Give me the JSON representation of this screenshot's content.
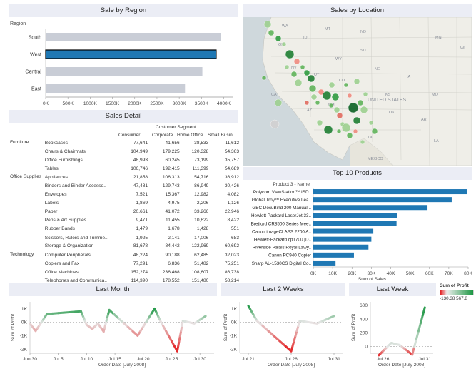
{
  "sales_by_region": {
    "title": "Sale by Region",
    "dimension_label": "Region",
    "axis_label": "Sum of Sales",
    "ticks": [
      "0K",
      "500K",
      "1000K",
      "1500K",
      "2000K",
      "2500K",
      "3000K",
      "3500K",
      "4000K"
    ],
    "bars": [
      {
        "label": "South",
        "value": 3940000,
        "selected": false
      },
      {
        "label": "West",
        "value": 3830000,
        "selected": true
      },
      {
        "label": "Central",
        "value": 3520000,
        "selected": false
      },
      {
        "label": "East",
        "value": 3130000,
        "selected": false
      }
    ],
    "max": 4200000,
    "bar_color": "#c9cdd6",
    "selected_color": "#1f78b4"
  },
  "sales_by_location": {
    "title": "Sales by Location",
    "state_labels": [
      "WA",
      "OR",
      "ID",
      "MT",
      "NV",
      "UT",
      "CO",
      "CA",
      "AZ",
      "NM",
      "TX",
      "NE",
      "KS",
      "OK",
      "IA",
      "UNITED STATES",
      "ND",
      "SD",
      "WY",
      "MEXICO",
      "MO",
      "AR",
      "LA",
      "MN",
      "WI"
    ]
  },
  "sales_detail": {
    "title": "Sales Detail",
    "group_header": "Customer Segment",
    "columns": [
      "Consumer",
      "Corporate",
      "Home Office",
      "Small Busin.."
    ],
    "groups": [
      {
        "category": "Furniture",
        "rows": [
          {
            "name": "Bookcases",
            "values": [
              "77,641",
              "41,656",
              "38,533",
              "11,612"
            ]
          },
          {
            "name": "Chairs & Chairmats",
            "values": [
              "104,949",
              "179,225",
              "120,328",
              "54,363"
            ]
          },
          {
            "name": "Office Furnishings",
            "values": [
              "48,993",
              "60,245",
              "73,199",
              "35,757"
            ]
          },
          {
            "name": "Tables",
            "values": [
              "106,746",
              "192,415",
              "111,399",
              "54,689"
            ]
          }
        ]
      },
      {
        "category": "Office Supplies",
        "rows": [
          {
            "name": "Appliances",
            "values": [
              "21,858",
              "106,313",
              "54,716",
              "36,912"
            ]
          },
          {
            "name": "Binders and Binder Accesso..",
            "values": [
              "47,481",
              "129,743",
              "86,949",
              "30,426"
            ]
          },
          {
            "name": "Envelopes",
            "values": [
              "7,521",
              "15,367",
              "12,982",
              "4,082"
            ]
          },
          {
            "name": "Labels",
            "values": [
              "1,869",
              "4,975",
              "2,206",
              "1,126"
            ]
          },
          {
            "name": "Paper",
            "values": [
              "20,661",
              "41,072",
              "33,266",
              "22,946"
            ]
          },
          {
            "name": "Pens & Art Supplies",
            "values": [
              "9,471",
              "11,455",
              "10,622",
              "8,422"
            ]
          },
          {
            "name": "Rubber Bands",
            "values": [
              "1,479",
              "1,678",
              "1,428",
              "551"
            ]
          },
          {
            "name": "Scissors, Rulers and Trimme..",
            "values": [
              "1,925",
              "2,141",
              "17,006",
              "683"
            ]
          },
          {
            "name": "Storage & Organization",
            "values": [
              "81,678",
              "84,442",
              "122,969",
              "60,692"
            ]
          }
        ]
      },
      {
        "category": "Technology",
        "rows": [
          {
            "name": "Computer Peripherals",
            "values": [
              "48,224",
              "90,188",
              "62,485",
              "32,023"
            ]
          },
          {
            "name": "Copiers and Fax",
            "values": [
              "77,291",
              "6,836",
              "51,482",
              "75,251"
            ]
          },
          {
            "name": "Office Machines",
            "values": [
              "152,274",
              "236,468",
              "108,607",
              "86,738"
            ]
          },
          {
            "name": "Telephones and Communica..",
            "values": [
              "114,390",
              "178,552",
              "151,480",
              "58,214"
            ]
          }
        ]
      }
    ]
  },
  "top_products": {
    "title": "Top 10 Products",
    "dimension_label": "Product 3 - Name",
    "axis_label": "Sum of Sales",
    "ticks": [
      "0K",
      "10K",
      "20K",
      "30K",
      "40K",
      "50K",
      "60K",
      "70K",
      "80K"
    ],
    "max": 80000,
    "bar_color": "#1f78b4",
    "products": [
      {
        "name": "Polycom ViewStation™ ISD..",
        "value": 79500
      },
      {
        "name": "Global Troy™ Executive Lea..",
        "value": 71500
      },
      {
        "name": "GBC DocuBind 200 Manual ..",
        "value": 59000
      },
      {
        "name": "Hewlett Packard LaserJet 33..",
        "value": 43500
      },
      {
        "name": "Bretford CR8500 Series Mee..",
        "value": 43000
      },
      {
        "name": "Canon imageCLASS 2200 A..",
        "value": 31000
      },
      {
        "name": "Hewlett-Packard cp1700 [D..",
        "value": 30000
      },
      {
        "name": "Riverside Palais Royal Lawy..",
        "value": 28500
      },
      {
        "name": "Canon PC940 Copier",
        "value": 21000
      },
      {
        "name": "Sharp AL-1530CS Digital Co..",
        "value": 11500
      }
    ]
  },
  "chart_data": [
    {
      "type": "line",
      "title": "Last Month",
      "xlabel": "Order Date [July 2008]",
      "ylabel": "Sum of Profit",
      "x_ticks": [
        "Jun 30",
        "Jul 5",
        "Jul 10",
        "Jul 15",
        "Jul 20",
        "Jul 25",
        "Jul 30"
      ],
      "y_ticks": [
        "1K",
        "0K",
        "-1K",
        "-2K"
      ],
      "ylim": [
        -2300,
        1500
      ],
      "xlim": [
        0,
        32.5
      ],
      "x": [
        0,
        1,
        3,
        9,
        10,
        11,
        12,
        13,
        14,
        19,
        22,
        23,
        26,
        27,
        29,
        31
      ],
      "y": [
        -100,
        -650,
        600,
        800,
        -200,
        -500,
        -100,
        -700,
        900,
        -1000,
        1000,
        100,
        -2150,
        100,
        -100,
        450
      ]
    },
    {
      "type": "line",
      "title": "Last 2 Weeks",
      "xlabel": "Order Date [July 2008]",
      "ylabel": "Sum of Profit",
      "x_ticks": [
        "Jul 21",
        "Jul 26",
        "Jul 31"
      ],
      "y_ticks": [
        "1K",
        "0K",
        "-1K",
        "-2K"
      ],
      "ylim": [
        -2300,
        1500
      ],
      "xlim": [
        20,
        32
      ],
      "x": [
        21,
        22,
        26,
        27,
        29,
        31
      ],
      "y": [
        1200,
        100,
        -2150,
        100,
        -100,
        450
      ]
    },
    {
      "type": "line",
      "title": "Last Week",
      "xlabel": "Order Date [July 2008]",
      "ylabel": "Sum of Profit",
      "x_ticks": [
        "Jul 26",
        "Jul 31"
      ],
      "y_ticks": [
        "600",
        "400",
        "200",
        "0"
      ],
      "ylim": [
        -100,
        650
      ],
      "xlim": [
        24.5,
        32
      ],
      "x": [
        25.5,
        27,
        28,
        29.5,
        31
      ],
      "y": [
        -130,
        50,
        20,
        -120,
        567.8
      ]
    }
  ],
  "profit_legend": {
    "title": "Sum of Profit",
    "min": "-130.38",
    "max": "567.8",
    "neg_color": "#e41a1c",
    "pos_color": "#1a9641"
  }
}
